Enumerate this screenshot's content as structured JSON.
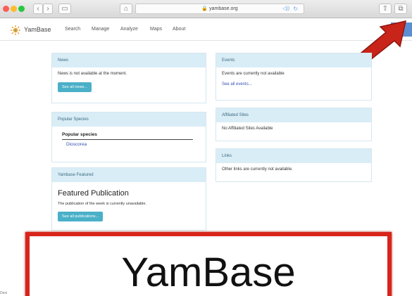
{
  "browser": {
    "url": "yambase.org",
    "back_icon": "chevron-left-icon",
    "forward_icon": "chevron-right-icon",
    "back_glyph": "‹",
    "forward_glyph": "›",
    "sidebar_glyph": "▭",
    "home_glyph": "⌂",
    "lock_glyph": "🔒",
    "reload_glyph": "↻",
    "audio_glyph": "◁))",
    "share_glyph": "⇧",
    "tabs_glyph": "⧉"
  },
  "navbar": {
    "brand": "YamBase",
    "links": [
      "Search",
      "Manage",
      "Analyze",
      "Maps",
      "About"
    ]
  },
  "news": {
    "title": "News",
    "text": "News is not available at the moment.",
    "button": "See all news..."
  },
  "popular": {
    "title": "Popular Species",
    "heading": "Popular species",
    "item": "Dioscorea"
  },
  "featured": {
    "title": "Yambase Featured",
    "heading": "Featured Publication",
    "text": "The publication of the week is currently unavailable.",
    "button": "See all publications..."
  },
  "events": {
    "title": "Events",
    "text": "Events are currently not available",
    "link": "See all events..."
  },
  "affiliated": {
    "title": "Affiliated Sites",
    "text": "No Affiliated Sites Available"
  },
  "links": {
    "title": "Links",
    "text": "Other links are currently not available."
  },
  "footer_fragment": "Desi",
  "banner": {
    "text": "YamBase"
  },
  "colors": {
    "accent": "#4ab0c8",
    "panel_head": "#d9edf6",
    "arrow": "#c9241a",
    "banner_border": "#d9241b"
  }
}
